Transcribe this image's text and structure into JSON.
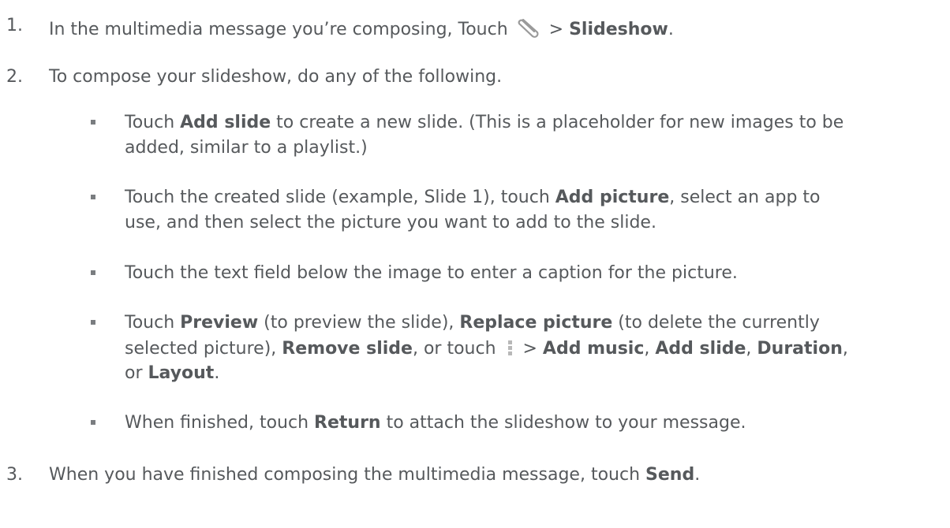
{
  "steps": [
    {
      "number": "1.",
      "parts": [
        "In the multimedia message you’re composing, Touch ",
        " > ",
        "Slideshow",
        "."
      ],
      "icon": "paperclip-icon"
    },
    {
      "number": "2.",
      "text": "To compose your slideshow, do any of the following."
    },
    {
      "number": "3.",
      "parts": [
        "When you have finished composing the multimedia message, touch ",
        "Send",
        "."
      ]
    }
  ],
  "bullets": [
    {
      "line1": [
        "Touch ",
        "Add slide",
        " to create a new slide. (This is a placeholder for new images to be"
      ],
      "line2": "added, similar to a playlist.)"
    },
    {
      "line1": [
        "Touch the created slide (example, Slide 1), touch ",
        "Add picture",
        ", select an app to"
      ],
      "line2": "use, and then select the picture you want to add to the slide."
    },
    {
      "line1": [
        "Touch the text field below the image to enter a caption for the picture."
      ]
    },
    {
      "line1": [
        "Touch ",
        "Preview",
        " (to preview the slide), ",
        "Replace picture",
        " (to delete the currently"
      ],
      "line2": [
        "selected picture), ",
        "Remove slide",
        ", or touch ",
        " > ",
        "Add music",
        ", ",
        "Add slide",
        ", ",
        "Duration",
        ","
      ],
      "line3": [
        "or ",
        "Layout",
        "."
      ],
      "icon": "more-vertical-icon"
    },
    {
      "line1": [
        "When finished, touch ",
        "Return",
        " to attach the slideshow to your message."
      ]
    }
  ]
}
